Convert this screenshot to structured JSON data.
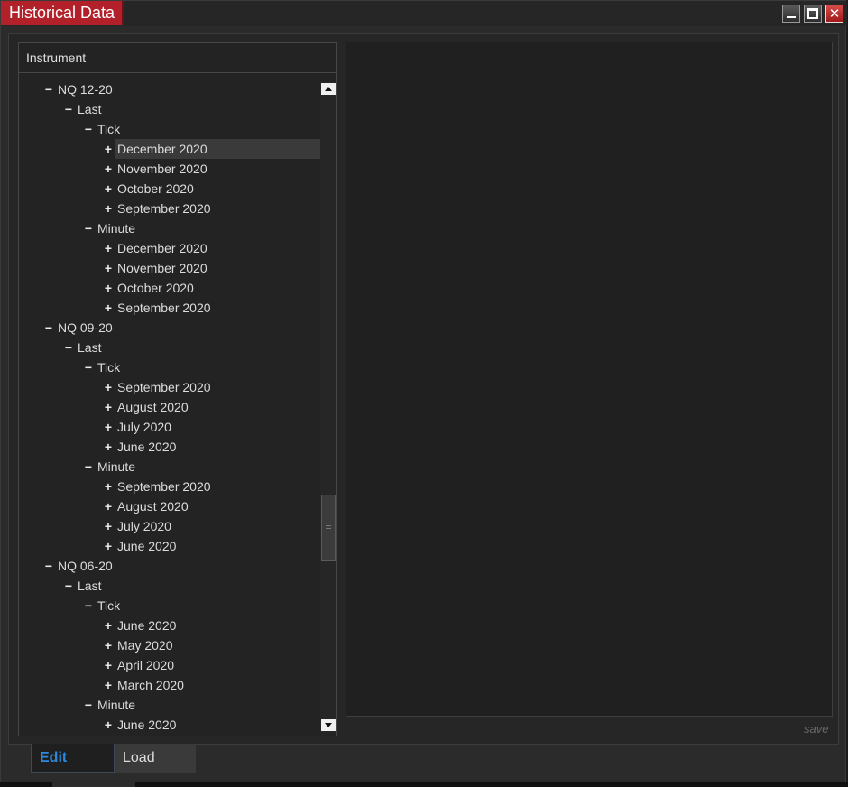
{
  "window": {
    "title": "Historical Data",
    "controls": {
      "minimize": "minimize-icon",
      "maximize": "maximize-icon",
      "close": "close-icon"
    },
    "accent_color": "#b2202a"
  },
  "tree": {
    "header": "Instrument",
    "nodes": [
      {
        "label": "NQ 12-20",
        "toggle": "−",
        "depth": 0
      },
      {
        "label": "Last",
        "toggle": "−",
        "depth": 1
      },
      {
        "label": "Tick",
        "toggle": "−",
        "depth": 2
      },
      {
        "label": "December 2020",
        "toggle": "+",
        "depth": 3,
        "selected": true
      },
      {
        "label": "November 2020",
        "toggle": "+",
        "depth": 3
      },
      {
        "label": "October 2020",
        "toggle": "+",
        "depth": 3
      },
      {
        "label": "September 2020",
        "toggle": "+",
        "depth": 3
      },
      {
        "label": "Minute",
        "toggle": "−",
        "depth": 2
      },
      {
        "label": "December 2020",
        "toggle": "+",
        "depth": 3
      },
      {
        "label": "November 2020",
        "toggle": "+",
        "depth": 3
      },
      {
        "label": "October 2020",
        "toggle": "+",
        "depth": 3
      },
      {
        "label": "September 2020",
        "toggle": "+",
        "depth": 3
      },
      {
        "label": "NQ 09-20",
        "toggle": "−",
        "depth": 0
      },
      {
        "label": "Last",
        "toggle": "−",
        "depth": 1
      },
      {
        "label": "Tick",
        "toggle": "−",
        "depth": 2
      },
      {
        "label": "September 2020",
        "toggle": "+",
        "depth": 3
      },
      {
        "label": "August 2020",
        "toggle": "+",
        "depth": 3
      },
      {
        "label": "July 2020",
        "toggle": "+",
        "depth": 3
      },
      {
        "label": "June 2020",
        "toggle": "+",
        "depth": 3
      },
      {
        "label": "Minute",
        "toggle": "−",
        "depth": 2
      },
      {
        "label": "September 2020",
        "toggle": "+",
        "depth": 3
      },
      {
        "label": "August 2020",
        "toggle": "+",
        "depth": 3
      },
      {
        "label": "July 2020",
        "toggle": "+",
        "depth": 3
      },
      {
        "label": "June 2020",
        "toggle": "+",
        "depth": 3
      },
      {
        "label": "NQ 06-20",
        "toggle": "−",
        "depth": 0
      },
      {
        "label": "Last",
        "toggle": "−",
        "depth": 1
      },
      {
        "label": "Tick",
        "toggle": "−",
        "depth": 2
      },
      {
        "label": "June 2020",
        "toggle": "+",
        "depth": 3
      },
      {
        "label": "May 2020",
        "toggle": "+",
        "depth": 3
      },
      {
        "label": "April 2020",
        "toggle": "+",
        "depth": 3
      },
      {
        "label": "March 2020",
        "toggle": "+",
        "depth": 3
      },
      {
        "label": "Minute",
        "toggle": "−",
        "depth": 2
      },
      {
        "label": "June 2020",
        "toggle": "+",
        "depth": 3
      }
    ]
  },
  "actions": {
    "save_label": "save"
  },
  "tabs": {
    "edit_label": "Edit",
    "load_label": "Load",
    "active": "Edit",
    "active_color": "#2d8ae0"
  }
}
